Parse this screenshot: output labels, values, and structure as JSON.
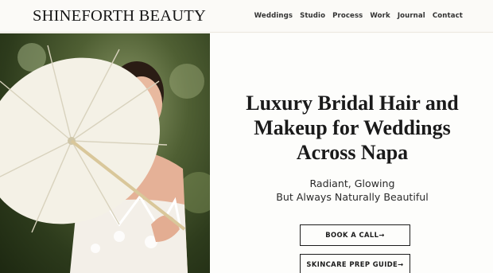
{
  "header": {
    "logo": "SHINEFORTH BEAUTY",
    "nav": [
      "Weddings",
      "Studio",
      "Process",
      "Work",
      "Journal",
      "Contact"
    ]
  },
  "hero": {
    "headline_lines": [
      "Luxury Bridal Hair and",
      "Makeup for Weddings",
      "Across Napa"
    ],
    "subhead_lines": [
      "Radiant, Glowing",
      "But Always Naturally Beautiful"
    ],
    "buttons": {
      "book": "BOOK A CALL→",
      "guide": "SKINCARE PREP GUIDE→"
    }
  },
  "colors": {
    "background": "#fdfdfb",
    "text": "#1c1c1c",
    "foliage": "#3f4f26"
  }
}
